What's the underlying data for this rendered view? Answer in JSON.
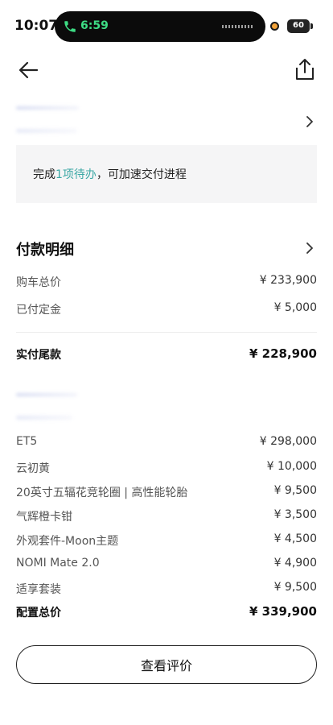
{
  "status_bar": {
    "time": "10:07",
    "call_time": "6:59",
    "battery": "60"
  },
  "task": {
    "prefix": "完成",
    "highlight": "1项待办",
    "suffix": "，可加速交付进程"
  },
  "payment": {
    "title": "付款明细",
    "rows": [
      {
        "label": "购车总价",
        "value": "¥ 233,900"
      },
      {
        "label": "已付定金",
        "value": "¥ 5,000"
      }
    ],
    "total": {
      "label": "实付尾款",
      "value": "¥ 228,900"
    }
  },
  "config": {
    "items": [
      {
        "label": "ET5",
        "value": "¥ 298,000"
      },
      {
        "label": "云初黄",
        "value": "¥ 10,000"
      },
      {
        "label": "20英寸五辐花竞轮圈 | 高性能轮胎",
        "value": "¥ 9,500"
      },
      {
        "label": "气辉橙卡钳",
        "value": "¥ 3,500"
      },
      {
        "label": "外观套件-Moon主题",
        "value": "¥ 4,500"
      },
      {
        "label": "NOMI Mate 2.0",
        "value": "¥ 4,900"
      },
      {
        "label": "适享套装",
        "value": "¥ 9,500"
      }
    ],
    "total": {
      "label": "配置总价",
      "value": "¥ 339,900"
    }
  },
  "review_button_label": "查看评价"
}
